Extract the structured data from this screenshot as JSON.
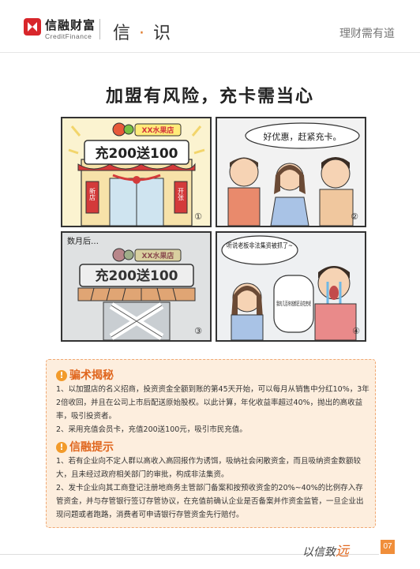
{
  "header": {
    "brand_cn": "信融财富",
    "brand_en": "CreditFinance",
    "column_title_a": "信",
    "column_title_dot": "·",
    "column_title_b": "识",
    "slogan": "理财需有道"
  },
  "comic": {
    "title": "加盟有风险，充卡需当心",
    "panels": [
      {
        "store_sign": "XX水果店",
        "promo_banner": "充200送100",
        "couplet_left": "新店",
        "couplet_right": "开张",
        "number": "①"
      },
      {
        "speech": "好优惠，赶紧充卡。",
        "number": "②"
      },
      {
        "caption": "数月后…",
        "store_sign": "XX水果店",
        "promo_banner": "充200送100",
        "number": "③"
      },
      {
        "speech_1": "听说老板非法集资被抓了~",
        "speech_2": "我的几百块钱都还没花完呢",
        "number": "④"
      }
    ]
  },
  "tips": {
    "section1_title": "骗术揭秘",
    "section1_paragraphs": [
      "1、以加盟店的名义招商，投资资金全额到账的第45天开始，可以每月从销售中分红10%，3年2倍收回，并且在公司上市后配送原始股权。以此计算，年化收益率超过40%，抛出的高收益率，吸引投资者。",
      "2、采用充值会员卡，充值200送100元，吸引市民充值。"
    ],
    "section2_title": "信融提示",
    "section2_paragraphs": [
      "1、若有企业向不定人群以高收入高回报作为诱饵，吸纳社会闲散资金，而且吸纳资金数额较大，且未经过政府相关部门的审批，构成非法集资。",
      "2、发卡企业向其工商登记注册地商务主管部门备案和按预收资金的20%~40%的比例存入存管资金，并与存管银行签订存管协议，在充值前确认企业是否备案并作资金监管，一旦企业出现问题或者跑路，消费者可申请银行存管资金先行赔付。"
    ],
    "icon_char": "!"
  },
  "footer": {
    "signature_a": "以信致",
    "signature_b": "远",
    "page_number": "07"
  },
  "colors": {
    "brand_red": "#d8262b",
    "accent_orange": "#e0671f",
    "box_bg": "#fdeede"
  }
}
